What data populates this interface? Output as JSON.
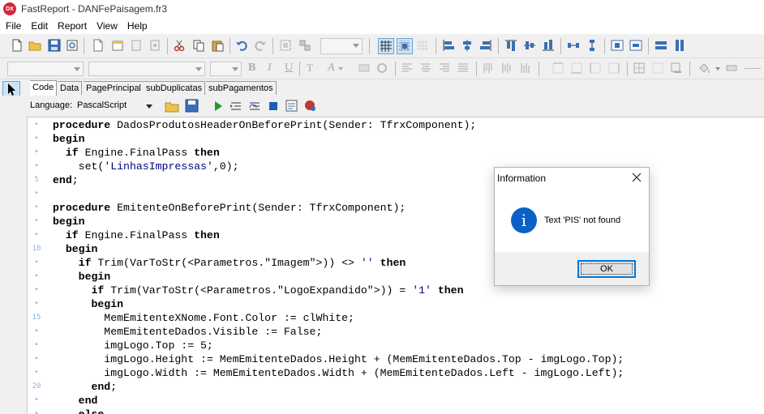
{
  "window": {
    "title": "FastReport - DANFePaisagem.fr3",
    "app_badge": "DX"
  },
  "menu": [
    "File",
    "Edit",
    "Report",
    "View",
    "Help"
  ],
  "tabs": [
    {
      "label": "Code",
      "active": true
    },
    {
      "label": "Data",
      "active": false
    },
    {
      "label": "PagePrincipal",
      "active": false
    },
    {
      "label": "subDuplicatas",
      "active": false
    },
    {
      "label": "subPagamentos",
      "active": false
    }
  ],
  "code_toolbar": {
    "language_label": "Language:",
    "language_value": "PascalScript"
  },
  "editor": {
    "line_numbers": [
      "5",
      "10",
      "15",
      "20"
    ],
    "lines": [
      [
        [
          "kw",
          "procedure"
        ],
        [
          "t",
          " DadosProdutosHeaderOnBeforePrint(Sender: TfrxComponent);"
        ]
      ],
      [
        [
          "kw",
          "begin"
        ]
      ],
      [
        [
          "t",
          "  "
        ],
        [
          "kw",
          "if"
        ],
        [
          "t",
          " Engine.FinalPass "
        ],
        [
          "kw",
          "then"
        ]
      ],
      [
        [
          "t",
          "    set("
        ],
        [
          "str",
          "'LinhasImpressas'"
        ],
        [
          "t",
          ",0);"
        ]
      ],
      [
        [
          "kw",
          "end"
        ],
        [
          "t",
          ";"
        ]
      ],
      [
        [
          "t",
          ""
        ]
      ],
      [
        [
          "kw",
          "procedure"
        ],
        [
          "t",
          " EmitenteOnBeforePrint(Sender: TfrxComponent);"
        ]
      ],
      [
        [
          "kw",
          "begin"
        ]
      ],
      [
        [
          "t",
          "  "
        ],
        [
          "kw",
          "if"
        ],
        [
          "t",
          " Engine.FinalPass "
        ],
        [
          "kw",
          "then"
        ]
      ],
      [
        [
          "t",
          "  "
        ],
        [
          "kw",
          "begin"
        ]
      ],
      [
        [
          "t",
          "    "
        ],
        [
          "kw",
          "if"
        ],
        [
          "t",
          " Trim(VarToStr(<Parametros.\"Imagem\">)) <> "
        ],
        [
          "str",
          "''"
        ],
        [
          "t",
          " "
        ],
        [
          "kw",
          "then"
        ]
      ],
      [
        [
          "t",
          "    "
        ],
        [
          "kw",
          "begin"
        ]
      ],
      [
        [
          "t",
          "      "
        ],
        [
          "kw",
          "if"
        ],
        [
          "t",
          " Trim(VarToStr(<Parametros.\"LogoExpandido\">)) = "
        ],
        [
          "str",
          "'1'"
        ],
        [
          "t",
          " "
        ],
        [
          "kw",
          "then"
        ]
      ],
      [
        [
          "t",
          "      "
        ],
        [
          "kw",
          "begin"
        ]
      ],
      [
        [
          "t",
          "        MemEmitenteXNome.Font.Color := clWhite;"
        ]
      ],
      [
        [
          "t",
          "        MemEmitenteDados.Visible := False;"
        ]
      ],
      [
        [
          "t",
          "        imgLogo.Top := 5;"
        ]
      ],
      [
        [
          "t",
          "        imgLogo.Height := MemEmitenteDados.Height + (MemEmitenteDados.Top - imgLogo.Top);"
        ]
      ],
      [
        [
          "t",
          "        imgLogo.Width := MemEmitenteDados.Width + (MemEmitenteDados.Left - imgLogo.Left);"
        ]
      ],
      [
        [
          "t",
          "      "
        ],
        [
          "kw",
          "end"
        ],
        [
          "t",
          ";"
        ]
      ],
      [
        [
          "t",
          "    "
        ],
        [
          "kw",
          "end"
        ]
      ],
      [
        [
          "t",
          "    "
        ],
        [
          "kw",
          "else"
        ]
      ]
    ]
  },
  "dialog": {
    "title": "Information",
    "message": "Text 'PIS' not found",
    "ok_label": "OK",
    "icon": "info-icon",
    "icon_glyph": "i"
  },
  "colors": {
    "accent": "#0078d7",
    "info_icon": "#0a62c7",
    "app_icon": "#d7263d",
    "line_number": "#8cb4d8"
  }
}
